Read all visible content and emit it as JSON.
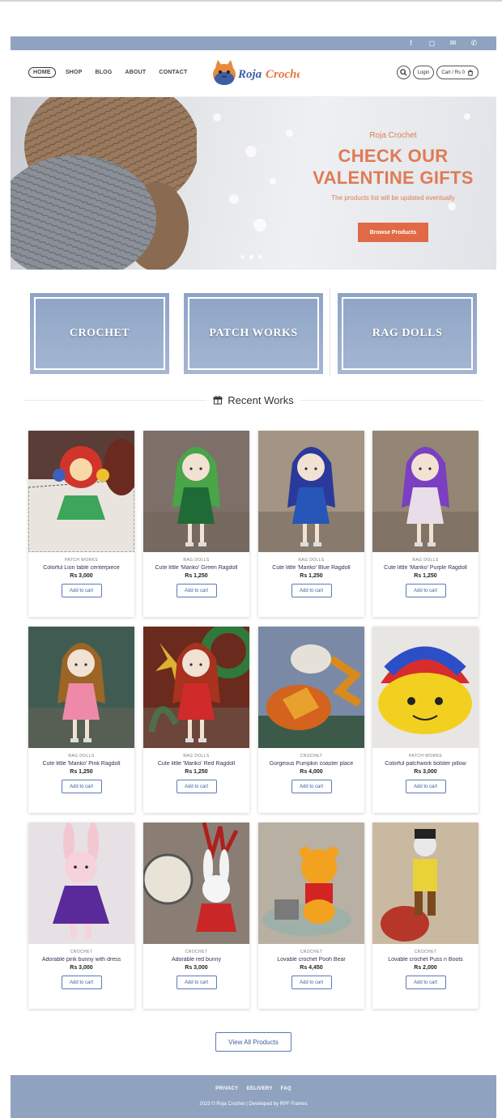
{
  "topbar": {
    "social": [
      {
        "icon": "facebook-icon",
        "glyph": "f"
      },
      {
        "icon": "instagram-icon",
        "glyph": "◻"
      },
      {
        "icon": "email-icon",
        "glyph": "✉"
      },
      {
        "icon": "phone-icon",
        "glyph": "✆"
      }
    ]
  },
  "header": {
    "nav": [
      "HOME",
      "SHOP",
      "BLOG",
      "ABOUT",
      "CONTACT"
    ],
    "logo_text": "Roja Crochet",
    "login_label": "Login",
    "cart_label": "Cart / Rs 0"
  },
  "hero": {
    "subtitle": "Roja Crochet",
    "title_line1": "CHECK OUR",
    "title_line2": "VALENTINE GIFTS",
    "text": "The products list will be updated eventually",
    "button": "Browse Products"
  },
  "categories": [
    "CROCHET",
    "PATCH WORKS",
    "RAG DOLLS"
  ],
  "section_title": "Recent Works",
  "products": [
    {
      "category": "PATCH WORKS",
      "name": "Colorful Lion table centerpiece",
      "price": "Rs 3,000",
      "button": "Add to cart",
      "art": "lion"
    },
    {
      "category": "RAG DOLLS",
      "name": "Cute little 'Mariko' Green Ragdoll",
      "price": "Rs 1,250",
      "button": "Add to cart",
      "art": "green-doll"
    },
    {
      "category": "RAG DOLLS",
      "name": "Cute little 'Mariko' Blue Ragdoll",
      "price": "Rs 1,250",
      "button": "Add to cart",
      "art": "blue-doll"
    },
    {
      "category": "RAG DOLLS",
      "name": "Cute little 'Mariko' Purple Ragdoll",
      "price": "Rs 1,250",
      "button": "Add to cart",
      "art": "purple-doll"
    },
    {
      "category": "RAG DOLLS",
      "name": "Cute little 'Mariko' Pink Ragdoll",
      "price": "Rs 1,250",
      "button": "Add to cart",
      "art": "pink-doll"
    },
    {
      "category": "RAG DOLLS",
      "name": "Cute little 'Mariko' Red Ragdoll",
      "price": "Rs 1,250",
      "button": "Add to cart",
      "art": "red-doll"
    },
    {
      "category": "CROCHET",
      "name": "Gorgeous Pumpkin coaster place",
      "price": "Rs 4,000",
      "button": "Add to cart",
      "art": "pumpkin"
    },
    {
      "category": "PATCH WORKS",
      "name": "Colorful patchwork bolster pillow",
      "price": "Rs 3,000",
      "button": "Add to cart",
      "art": "pillow"
    },
    {
      "category": "CROCHET",
      "name": "Adorable pink bunny with dress",
      "price": "Rs 3,000",
      "button": "Add to cart",
      "art": "bunny-purple"
    },
    {
      "category": "CROCHET",
      "name": "Adorable red bunny",
      "price": "Rs 3,000",
      "button": "Add to cart",
      "art": "bunny-red"
    },
    {
      "category": "CROCHET",
      "name": "Lovable crochet Pooh Bear",
      "price": "Rs 4,450",
      "button": "Add to cart",
      "art": "pooh"
    },
    {
      "category": "CROCHET",
      "name": "Lovable crochet Puss n Boots",
      "price": "Rs 2,000",
      "button": "Add to cart",
      "art": "puss"
    }
  ],
  "view_all": "View All Products",
  "footer": {
    "links": [
      "PRIVACY",
      "DELIVERY",
      "FAQ"
    ],
    "copyright": "2023 © Roja Crochet | Developed by RPF Frames"
  },
  "colors": {
    "brand_blue": "#8fa3c1",
    "accent_orange": "#e06a45",
    "button_blue": "#3d5f9e"
  }
}
